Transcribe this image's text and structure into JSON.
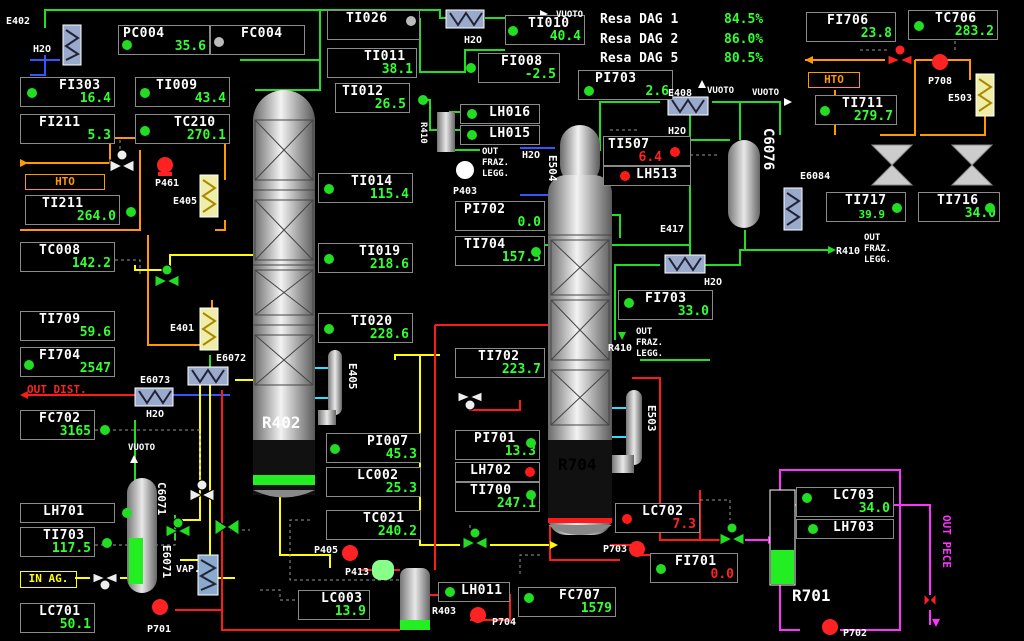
{
  "resa": [
    {
      "label": "Resa DAG 1",
      "value": "84.5%"
    },
    {
      "label": "Resa DAG 2",
      "value": "86.0%"
    },
    {
      "label": "Resa DAG 5",
      "value": "80.5%"
    }
  ],
  "tags": {
    "PC004": {
      "name": "PC004",
      "value": "35.6"
    },
    "FC004": {
      "name": "FC004",
      "value": ""
    },
    "TI026": {
      "name": "TI026",
      "value": ""
    },
    "TI010": {
      "name": "TI010",
      "value": "40.4"
    },
    "TI011": {
      "name": "TI011",
      "value": "38.1"
    },
    "FI008": {
      "name": "FI008",
      "value": "-2.5"
    },
    "TI012": {
      "name": "TI012",
      "value": "26.5"
    },
    "FI303": {
      "name": "FI303",
      "value": "16.4"
    },
    "TI009": {
      "name": "TI009",
      "value": "43.4"
    },
    "FI211": {
      "name": "FI211",
      "value": "5.3"
    },
    "TC210": {
      "name": "TC210",
      "value": "270.1"
    },
    "TI211": {
      "name": "TI211",
      "value": "264.0"
    },
    "TC008": {
      "name": "TC008",
      "value": "142.2"
    },
    "TI014": {
      "name": "TI014",
      "value": "115.4"
    },
    "TI019": {
      "name": "TI019",
      "value": "218.6"
    },
    "TI020": {
      "name": "TI020",
      "value": "228.6"
    },
    "TI709": {
      "name": "TI709",
      "value": "59.6"
    },
    "FI704": {
      "name": "FI704",
      "value": "2547"
    },
    "FC702": {
      "name": "FC702",
      "value": "3165"
    },
    "PI007": {
      "name": "PI007",
      "value": "45.3"
    },
    "LC002": {
      "name": "LC002",
      "value": "25.3"
    },
    "TC021": {
      "name": "TC021",
      "value": "240.2"
    },
    "LH701": {
      "name": "LH701",
      "value": ""
    },
    "TI703": {
      "name": "TI703",
      "value": "117.5"
    },
    "LC701": {
      "name": "LC701",
      "value": "50.1"
    },
    "LC003": {
      "name": "LC003",
      "value": "13.9"
    },
    "LH011": {
      "name": "LH011",
      "value": ""
    },
    "FC707": {
      "name": "FC707",
      "value": "1579"
    },
    "LH016": {
      "name": "LH016",
      "value": ""
    },
    "LH015": {
      "name": "LH015",
      "value": ""
    },
    "PI703": {
      "name": "PI703",
      "value": "2.6"
    },
    "TI507": {
      "name": "TI507",
      "value": "6.4"
    },
    "LH513": {
      "name": "LH513",
      "value": ""
    },
    "PI702": {
      "name": "PI702",
      "value": "0.0"
    },
    "TI704": {
      "name": "TI704",
      "value": "157.3"
    },
    "FI703": {
      "name": "FI703",
      "value": "33.0"
    },
    "TI702": {
      "name": "TI702",
      "value": "223.7"
    },
    "PI701": {
      "name": "PI701",
      "value": "13.3"
    },
    "LH702": {
      "name": "LH702",
      "value": ""
    },
    "TI700": {
      "name": "TI700",
      "value": "247.1"
    },
    "LC702": {
      "name": "LC702",
      "value": "7.3"
    },
    "FI701": {
      "name": "FI701",
      "value": "0.0"
    },
    "FI706": {
      "name": "FI706",
      "value": "23.8"
    },
    "TC706": {
      "name": "TC706",
      "value": "283.2"
    },
    "TI711": {
      "name": "TI711",
      "value": "279.7"
    },
    "TI717": {
      "name": "TI717",
      "value": "39.9"
    },
    "TI716": {
      "name": "TI716",
      "value": "34.0"
    },
    "LC703": {
      "name": "LC703",
      "value": "34.0"
    },
    "LH703": {
      "name": "LH703",
      "value": ""
    }
  },
  "labels": {
    "E402": "E402",
    "H2O_a": "H2O",
    "HTO_a": "HTO",
    "P461": "P461",
    "E405a": "E405",
    "E401": "E401",
    "E6072": "E6072",
    "E6073": "E6073",
    "H2O_b": "H2O",
    "OUT_DIST": "OUT DIST.",
    "VUOTO_a": "VUOTO",
    "C6071": "C6071",
    "E6071": "E6071",
    "VAP": "VAP.",
    "IN_AG": "IN AG.",
    "P701": "P701",
    "R402": "R402",
    "E405b": "E405",
    "P405": "P405",
    "P413": "P413",
    "R403": "R403",
    "P704": "P704",
    "H2O_c": "H2O",
    "R410a": "R410",
    "OUT_FRAZ_a": "OUT\nFRAZ.\nLEGG.",
    "P403": "P403",
    "VUOTO_b": "VUOTO",
    "E408": "E408",
    "VUOTO_c": "VUOTO",
    "VUOTO_d": "VUOTO",
    "H2O_d": "H2O",
    "E504": "E504",
    "H2O_e": "H2O",
    "C6076": "C6076",
    "E6084": "E6084",
    "R410b": "R410",
    "OUT_FRAZ_b": "OUT\nFRAZ.\nLEGG.",
    "E417": "E417",
    "H2O_f": "H2O",
    "OUT_FRAZ_c": "OUT\nFRAZ.\nLEGG.",
    "R410c": "R410",
    "R704": "R704",
    "E503": "E503",
    "P703": "P703",
    "R701": "R701",
    "P702": "P702",
    "OUT_PECE": "OUT PECE",
    "HTO_b": "HTO",
    "P708": "P708",
    "E503b": "E503"
  },
  "colors": {
    "accent_green": "#33ff33",
    "alarm_red": "#ff2222",
    "hto_orange": "#ff9900",
    "pipe_yellow": "#ffff00",
    "pipe_magenta": "#ff33ff",
    "pipe_blue": "#3355ff"
  }
}
